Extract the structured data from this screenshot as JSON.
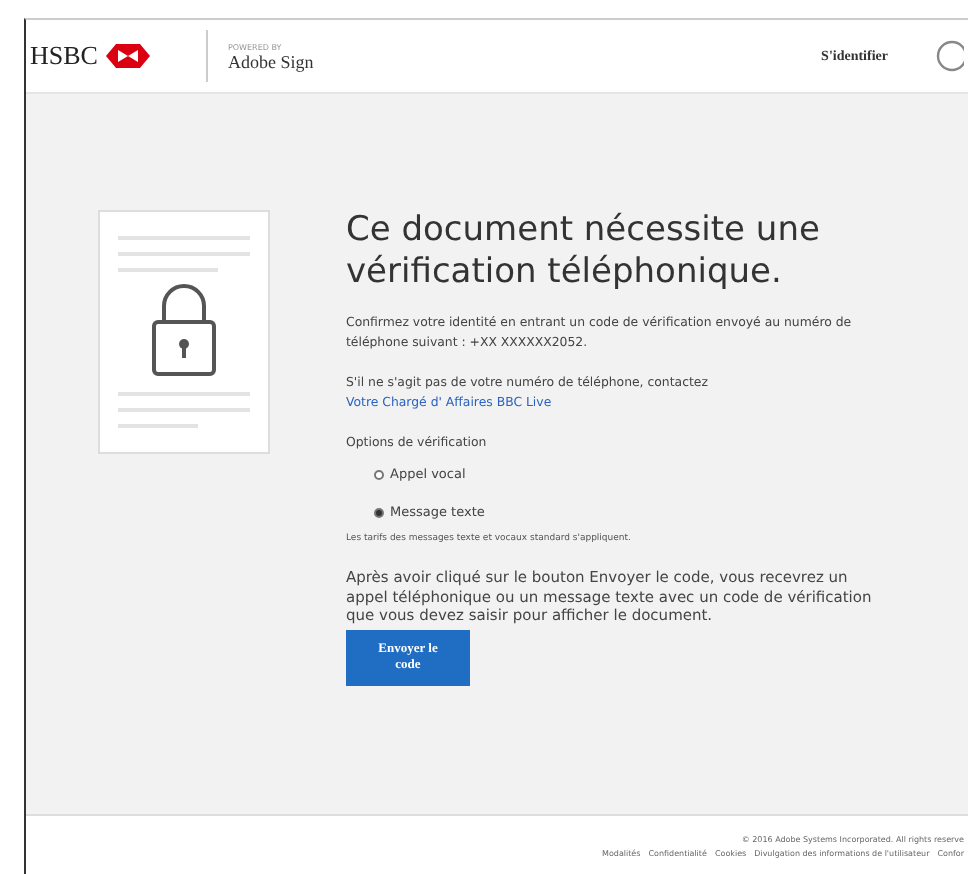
{
  "header": {
    "bank_logo": "HSBC",
    "powered_by": "POWERED BY",
    "product": "Adobe Sign",
    "sign_in": "S'identifier"
  },
  "main": {
    "title": "Ce document nécessite une vérification téléphonique.",
    "intro": "Confirmez votre identité en entrant un code de vérification envoyé au numéro de téléphone suivant : +XX XXXXXX2052.",
    "contact_text": "S'il ne s'agit pas de votre numéro de téléphone, contactez ",
    "contact_link": "Votre Chargé d' Affaires BBC Live",
    "options_label": "Options de vérification",
    "options": [
      {
        "label": "Appel vocal",
        "selected": false
      },
      {
        "label": "Message texte",
        "selected": true
      }
    ],
    "rates_note": "Les tarifs des messages texte et vocaux standard s'appliquent.",
    "instructions": "Après avoir cliqué sur le bouton Envoyer le code, vous recevrez un appel téléphonique ou un message texte avec un code de vérification que vous devez saisir pour afficher le document.",
    "send_button": "Envoyer le code"
  },
  "footer": {
    "copyright": "© 2016 Adobe Systems Incorporated. All rights reserve",
    "links": [
      "Modalités",
      "Confidentialité",
      "Cookies",
      "Divulgation des informations de l'utilisateur",
      "Confor"
    ]
  }
}
